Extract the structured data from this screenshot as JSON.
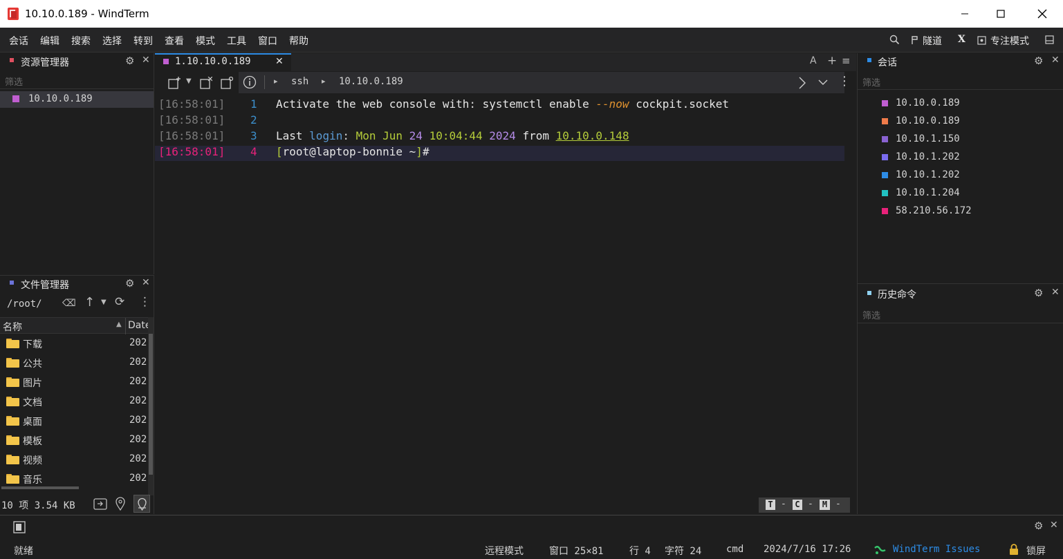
{
  "window": {
    "title": "10.10.0.189 - WindTerm",
    "minimize": "–",
    "maximize": "☐",
    "close": "✕"
  },
  "menu": {
    "items": [
      "会话",
      "编辑",
      "搜索",
      "选择",
      "转到",
      "查看",
      "模式",
      "工具",
      "窗口",
      "帮助"
    ],
    "tunnel": "隧道",
    "x_label": "X",
    "focus_mode": "专注模式"
  },
  "explorer": {
    "title": "资源管理器",
    "filter_placeholder": "筛选",
    "items": [
      "10.10.0.189"
    ],
    "item_color": "#c05ed1"
  },
  "file_manager": {
    "title": "文件管理器",
    "path": "/root/",
    "col_name": "名称",
    "col_date": "Date",
    "rows": [
      {
        "name": "下载",
        "date": "202"
      },
      {
        "name": "公共",
        "date": "202"
      },
      {
        "name": "图片",
        "date": "202"
      },
      {
        "name": "文档",
        "date": "202"
      },
      {
        "name": "桌面",
        "date": "202"
      },
      {
        "name": "模板",
        "date": "202"
      },
      {
        "name": "视频",
        "date": "202"
      },
      {
        "name": "音乐",
        "date": "202"
      }
    ],
    "footer": "10 项 3.54 KB"
  },
  "tabs": [
    {
      "label": "1.10.10.0.189",
      "close": "✕",
      "color": "#c05ed1"
    }
  ],
  "tab_actions": {
    "font": "A",
    "add": "+",
    "menu": "≡"
  },
  "toolbar": {
    "breadcrumb_sep": "▸",
    "crumb_1": "ssh",
    "crumb_2": "10.10.0.189"
  },
  "terminal": {
    "lines": [
      {
        "ts": "[16:58:01]",
        "num": "1",
        "segments": [
          {
            "t": "Activate the web console with",
            "c": "#e6e6e6"
          },
          {
            "t": ": ",
            "c": "#d4d4d4"
          },
          {
            "t": "systemctl enable ",
            "c": "#e6e6e6"
          },
          {
            "t": "--now",
            "c": "#e0922f",
            "i": true
          },
          {
            "t": " cockpit.socket",
            "c": "#e6e6e6"
          }
        ]
      },
      {
        "ts": "[16:58:01]",
        "num": "2",
        "segments": []
      },
      {
        "ts": "[16:58:01]",
        "num": "3",
        "segments": [
          {
            "t": "Last ",
            "c": "#e6e6e6"
          },
          {
            "t": "login",
            "c": "#5b9bd5"
          },
          {
            "t": ": ",
            "c": "#d4d4d4"
          },
          {
            "t": "Mon Jun ",
            "c": "#b5cd3a"
          },
          {
            "t": "24",
            "c": "#b58ce8"
          },
          {
            "t": " ",
            "c": "#b5cd3a"
          },
          {
            "t": "10:04:44",
            "c": "#b5cd3a"
          },
          {
            "t": " ",
            "c": "#e6e6e6"
          },
          {
            "t": "2024",
            "c": "#b58ce8"
          },
          {
            "t": " from ",
            "c": "#e6e6e6"
          },
          {
            "t": "10.10.0.148",
            "c": "#b5cd3a",
            "u": true
          }
        ]
      },
      {
        "ts": "[16:58:01]",
        "num": "4",
        "active": true,
        "segments": [
          {
            "t": "[",
            "c": "#b5cd3a"
          },
          {
            "t": "root@laptop-bonnie ~",
            "c": "#e6e6e6"
          },
          {
            "t": "]",
            "c": "#b5cd3a"
          },
          {
            "t": "#",
            "c": "#e6e6e6"
          }
        ]
      }
    ],
    "mode_badges": [
      "T",
      "-",
      "C",
      "-",
      "M",
      "-"
    ]
  },
  "sessions": {
    "title": "会话",
    "filter_placeholder": "筛选",
    "items": [
      {
        "label": "10.10.0.189",
        "color": "#c05ed1"
      },
      {
        "label": "10.10.0.189",
        "color": "#ef7b4a"
      },
      {
        "label": "10.10.1.150",
        "color": "#8a63d2"
      },
      {
        "label": "10.10.1.202",
        "color": "#7a6cf0"
      },
      {
        "label": "10.10.1.202",
        "color": "#2d8ce6"
      },
      {
        "label": "10.10.1.204",
        "color": "#22c2c2"
      },
      {
        "label": "58.210.56.172",
        "color": "#e8227a"
      }
    ]
  },
  "history": {
    "title": "历史命令",
    "filter_placeholder": "筛选"
  },
  "statusbar": {
    "ready": "就绪",
    "remote_mode": "远程模式",
    "window_size": "窗口 25×81",
    "row": "行 4",
    "col": "字符 24",
    "shell": "cmd",
    "datetime": "2024/7/16 17:26",
    "issues": "WindTerm Issues",
    "lock": "锁屏"
  }
}
